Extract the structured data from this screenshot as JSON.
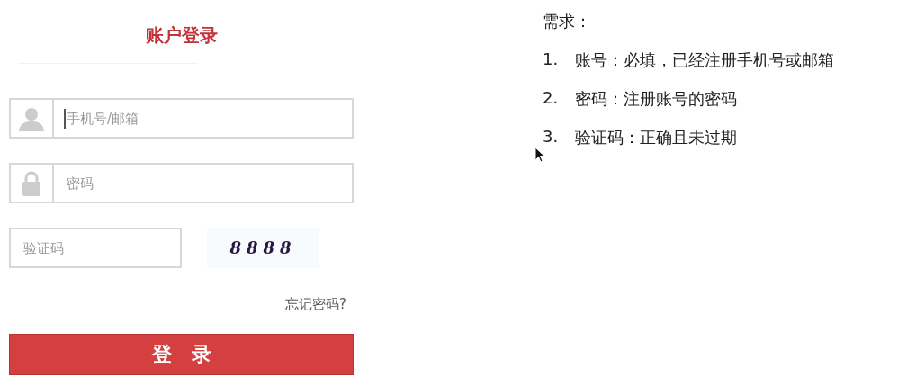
{
  "login": {
    "title": "账户登录",
    "fields": [
      {
        "kind": "user",
        "placeholder": "手机号/邮箱",
        "focused": true
      },
      {
        "kind": "lock",
        "placeholder": "密码",
        "focused": false
      }
    ],
    "captcha": {
      "placeholder": "验证码",
      "code": "8888"
    },
    "forgot_link": "忘记密码?",
    "submit": "登　录"
  },
  "requirements": {
    "title": "需求：",
    "items": [
      {
        "number": "1.",
        "text": "账号：必填，已经注册手机号或邮箱"
      },
      {
        "number": "2.",
        "text": "密码：注册账号的密码"
      },
      {
        "number": "3.",
        "text": "验证码：正确且未过期"
      }
    ]
  }
}
